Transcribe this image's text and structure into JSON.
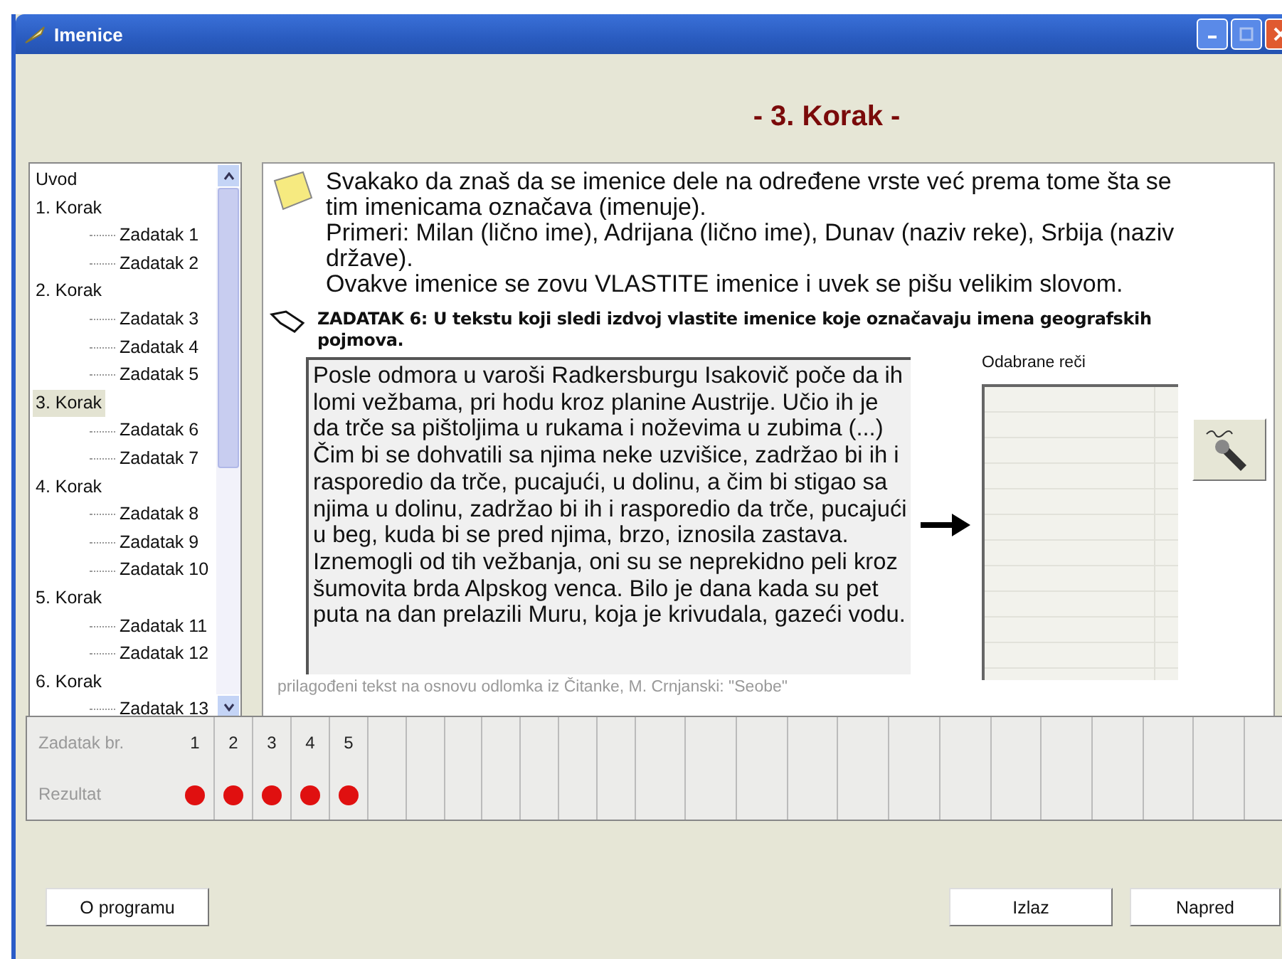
{
  "window": {
    "title": "Imenice"
  },
  "heading": "- 3. Korak -",
  "tree": [
    {
      "label": "Uvod",
      "selected": false
    },
    {
      "label": "1. Korak",
      "selected": false,
      "children": [
        {
          "label": "Zadatak 1",
          "selected": false
        },
        {
          "label": "Zadatak 2",
          "selected": false
        }
      ]
    },
    {
      "label": "2. Korak",
      "selected": false,
      "children": [
        {
          "label": "Zadatak 3",
          "selected": false
        },
        {
          "label": "Zadatak 4",
          "selected": false
        },
        {
          "label": "Zadatak 5",
          "selected": false
        }
      ]
    },
    {
      "label": "3. Korak",
      "selected": true,
      "children": [
        {
          "label": "Zadatak 6",
          "selected": false
        },
        {
          "label": "Zadatak 7",
          "selected": false
        }
      ]
    },
    {
      "label": "4. Korak",
      "selected": false,
      "children": [
        {
          "label": "Zadatak 8",
          "selected": false
        },
        {
          "label": "Zadatak 9",
          "selected": false
        },
        {
          "label": "Zadatak 10",
          "selected": false
        }
      ]
    },
    {
      "label": "5. Korak",
      "selected": false,
      "children": [
        {
          "label": "Zadatak 11",
          "selected": false
        },
        {
          "label": "Zadatak 12",
          "selected": false
        }
      ]
    },
    {
      "label": "6. Korak",
      "selected": false,
      "children": [
        {
          "label": "Zadatak 13",
          "selected": false
        }
      ]
    }
  ],
  "intro": [
    "Svakako da znaš da se imenice dele na određene vrste već prema tome šta se tim imenicama označava (imenuje).",
    "Primeri: Milan (lično ime), Adrijana (lično ime), Dunav (naziv reke), Srbija (naziv države).",
    "Ovakve imenice se zovu VLASTITE imenice i uvek se pišu velikim slovom."
  ],
  "task": "ZADATAK 6: U tekstu koji sledi izdvoj vlastite imenice koje označavaju imena geografskih pojmova.",
  "passage": "Posle odmora u varoši Radkersburgu Isakovič poče da ih lomi vežbama, pri hodu kroz planine Austrije. Učio ih je da trče sa pištoljima u rukama i noževima u zubima (...) Čim bi se dohvatili sa njima neke uzvišice, zadržao bi ih i rasporedio da trče, pucajući, u dolinu, a čim bi stigao sa njima u dolinu, zadržao bi ih i rasporedio da trče, pucajući u beg, kuda bi se pred njima, brzo, iznosila zastava. Iznemogli od tih vežbanja, oni su se neprekidno peli kroz šumovita brda Alpskog venca. Bilo je dana kada su pet puta na dan prelazili Muru, koja je krivudala, gazeći vodu.",
  "caption": "prilagođeni tekst na osnovu odlomka iz Čitanke, M. Crnjanski: \"Seobe\"",
  "selected_words": {
    "label": "Odabrane reči"
  },
  "results": {
    "row_1_label": "Zadatak br.",
    "row_2_label": "Rezultat",
    "tasks": [
      {
        "number": "1",
        "color": "#e01010"
      },
      {
        "number": "2",
        "color": "#e01010"
      },
      {
        "number": "3",
        "color": "#e01010"
      },
      {
        "number": "4",
        "color": "#e01010"
      },
      {
        "number": "5",
        "color": "#e01010"
      }
    ]
  },
  "buttons": {
    "about": "O programu",
    "exit": "Izlaz",
    "next": "Napred"
  }
}
